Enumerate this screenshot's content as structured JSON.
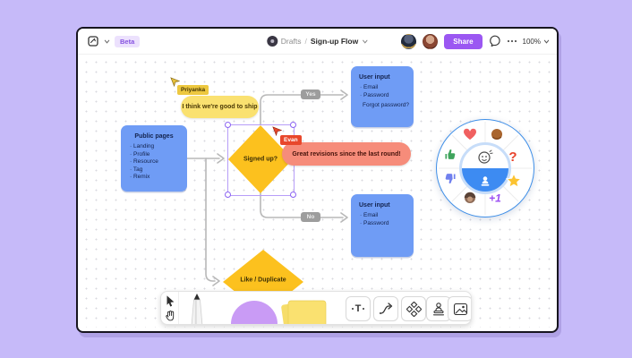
{
  "colors": {
    "page_background": "#c6baf9",
    "accent_purple": "#9b57f2",
    "figjam_blue": "#6f9cf5",
    "figjam_yellow": "#fcc11e",
    "bubble_yellow": "#fae170",
    "bubble_red": "#f68c7a",
    "tag_red": "#e8472b",
    "tag_yellow": "#edc83f",
    "wheel_blue": "#3d8bf2",
    "connector_gray": "#b8b8b8"
  },
  "topbar": {
    "beta_badge": "Beta",
    "breadcrumb": {
      "folder": "Drafts",
      "separator": "/",
      "file": "Sign-up Flow"
    },
    "share_button": "Share",
    "zoom_value": "100%"
  },
  "canvas": {
    "public_pages": {
      "title": "Public pages",
      "items": [
        "Landing",
        "Profile",
        "Resource",
        "Tag",
        "Remix"
      ]
    },
    "signed_up_diamond": "Signed up?",
    "like_duplicate_diamond": "Like / Duplicate",
    "yes_label": "Yes",
    "no_label": "No",
    "user_input_top": {
      "title": "User input",
      "items": [
        "Email",
        "Password"
      ],
      "link": "Forgot password?"
    },
    "user_input_bottom": {
      "title": "User input",
      "items": [
        "Email",
        "Password"
      ]
    },
    "comments": {
      "priyanka": {
        "name": "Priyanka",
        "message": "I think we're good to ship"
      },
      "evan": {
        "name": "Evan",
        "message": "Great revisions since the last round!"
      }
    },
    "wheel": {
      "question_glyph": "?",
      "plus_one_glyph": "+1"
    }
  },
  "toolbar": {
    "text_tool_glyph": "T"
  }
}
